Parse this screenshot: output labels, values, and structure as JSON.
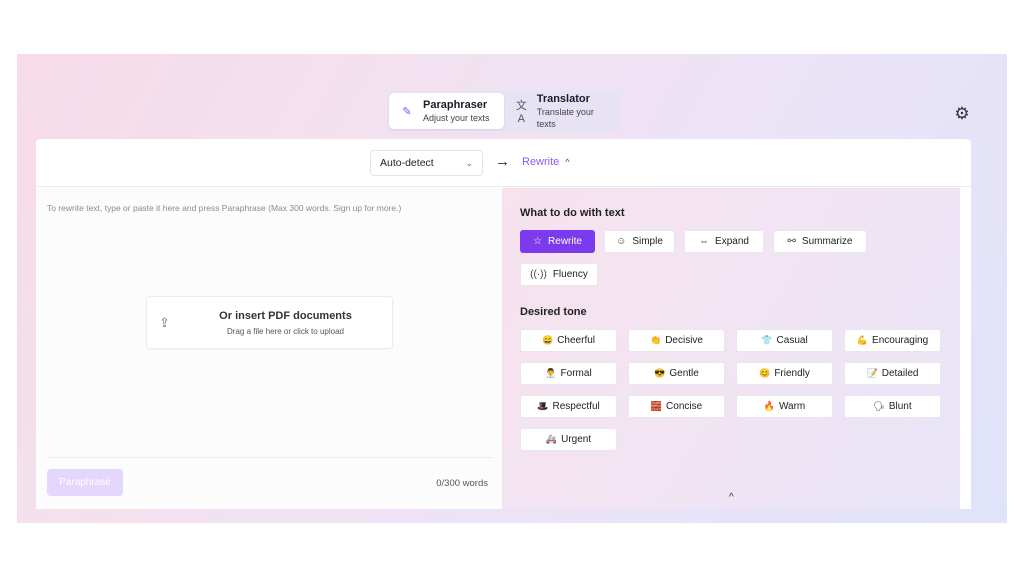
{
  "modes": [
    {
      "title": "Paraphraser",
      "subtitle": "Adjust your texts",
      "icon": "pencil-icon"
    },
    {
      "title": "Translator",
      "subtitle": "Translate your texts",
      "icon": "translate-icon"
    }
  ],
  "toolbar": {
    "language": "Auto-detect",
    "mode": "Rewrite"
  },
  "editor": {
    "placeholder": "To rewrite text, type or paste it here and press Paraphrase (Max 300 words. Sign up for more.)",
    "pdf_title": "Or insert PDF documents",
    "pdf_subtitle": "Drag a file here or click to upload",
    "button": "Paraphrase",
    "word_count": "0/300 words"
  },
  "options": {
    "title": "What to do with text",
    "items": [
      {
        "label": "Rewrite",
        "icon": "star-icon",
        "glyph": "☆"
      },
      {
        "label": "Simple",
        "icon": "smile-icon",
        "glyph": "☺"
      },
      {
        "label": "Expand",
        "icon": "expand-icon",
        "glyph": "⇔"
      },
      {
        "label": "Summarize",
        "icon": "summarize-icon",
        "glyph": "⚯"
      },
      {
        "label": "Fluency",
        "icon": "broadcast-icon",
        "glyph": "((·))"
      }
    ],
    "active": "Rewrite"
  },
  "tone": {
    "title": "Desired tone",
    "items": [
      {
        "label": "Cheerful",
        "emoji": "😄"
      },
      {
        "label": "Decisive",
        "emoji": "👏"
      },
      {
        "label": "Casual",
        "emoji": "👕"
      },
      {
        "label": "Encouraging",
        "emoji": "💪"
      },
      {
        "label": "Formal",
        "emoji": "👨‍💼"
      },
      {
        "label": "Gentle",
        "emoji": "😎"
      },
      {
        "label": "Friendly",
        "emoji": "😊"
      },
      {
        "label": "Detailed",
        "emoji": "📝"
      },
      {
        "label": "Respectful",
        "emoji": "🎩"
      },
      {
        "label": "Concise",
        "emoji": "🧱"
      },
      {
        "label": "Warm",
        "emoji": "🔥"
      },
      {
        "label": "Blunt",
        "emoji": "🗣"
      },
      {
        "label": "Urgent",
        "emoji": "🚑"
      }
    ]
  },
  "colors": {
    "accent": "#7c3aed",
    "accent_text": "#8b5cf6"
  }
}
